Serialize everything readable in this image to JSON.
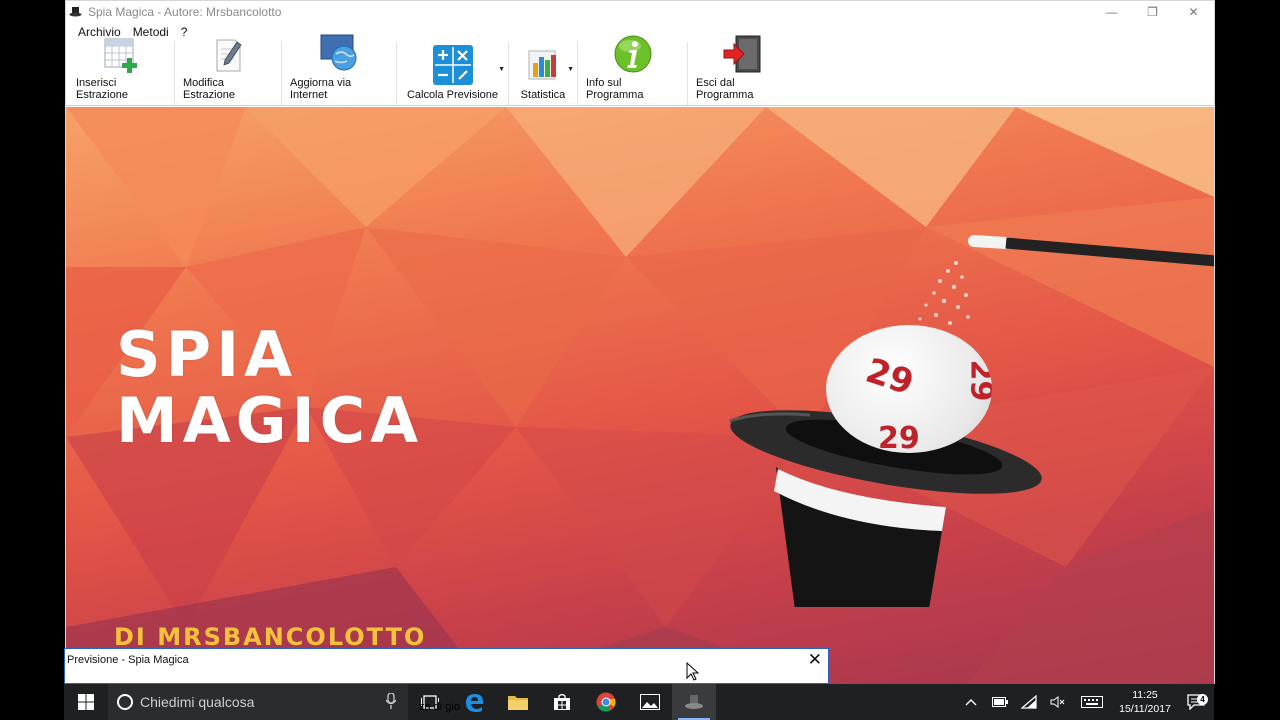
{
  "window": {
    "title": "Spia Magica - Autore: Mrsbancolotto",
    "controls": {
      "minimize": "—",
      "restore": "❐",
      "close": "✕"
    }
  },
  "menu": {
    "items": [
      "Archivio",
      "Metodi",
      "?"
    ]
  },
  "toolbar": {
    "buttons": [
      {
        "label": "Inserisci Estrazione",
        "icon": "insert-grid-icon"
      },
      {
        "label": "Modifica Estrazione",
        "icon": "edit-document-icon"
      },
      {
        "label": "Aggiorna via Internet",
        "icon": "globe-monitor-icon"
      },
      {
        "label": "Calcola Previsione",
        "icon": "calculator-icon",
        "has_dropdown": true
      },
      {
        "label": "Statistica",
        "icon": "bar-chart-icon",
        "has_dropdown": true
      },
      {
        "label": "Info sul Programma",
        "icon": "info-icon"
      },
      {
        "label": "Esci dal Programma",
        "icon": "exit-door-icon"
      }
    ]
  },
  "splash": {
    "title_line1": "SPIA",
    "title_line2": "MAGICA",
    "author": "DI MRSBANCOLOTTO",
    "ball_number": "29",
    "colors": {
      "accent_gold": "#f2c23a",
      "bg_top": "#f6a36a",
      "bg_bottom": "#a3364f"
    }
  },
  "dialog": {
    "title": "Previsione - Spia Magica",
    "close": "✕"
  },
  "taskbar": {
    "search_placeholder": "Chiedimi qualcosa",
    "obscured_text": "za di gio",
    "apps": [
      "task-view-icon",
      "edge-icon",
      "file-explorer-icon",
      "store-icon",
      "chrome-icon",
      "photos-icon",
      "spia-magica-icon"
    ],
    "clock": {
      "time": "11:25",
      "date": "15/11/2017"
    },
    "notification_count": "4"
  }
}
